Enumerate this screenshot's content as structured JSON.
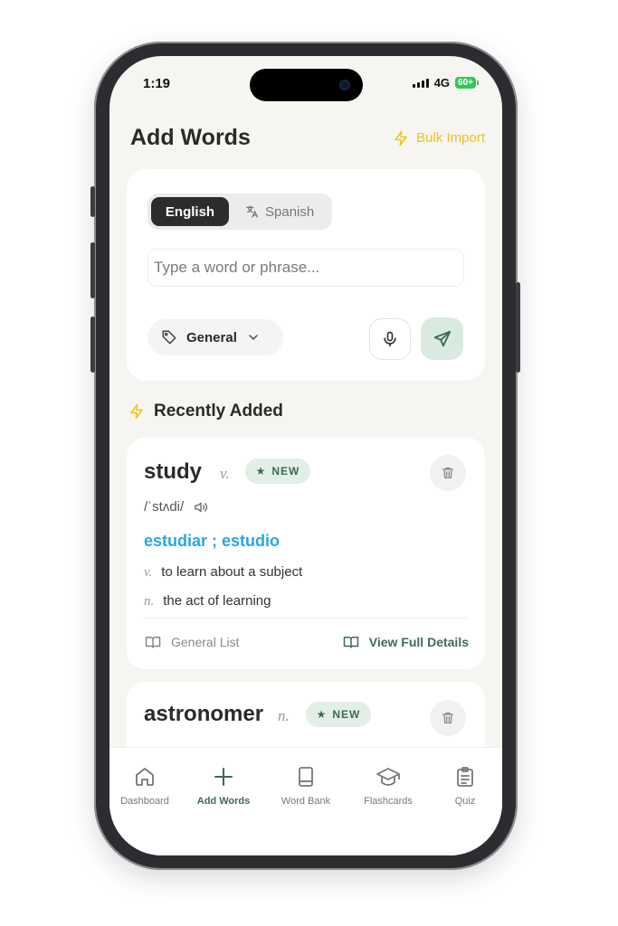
{
  "status_bar": {
    "time": "1:19",
    "network": "4G",
    "battery": "60+"
  },
  "header": {
    "title": "Add Words",
    "bulk_import_label": "Bulk Import"
  },
  "add_form": {
    "languages": [
      "English",
      "Spanish"
    ],
    "selected_language": "English",
    "input_placeholder": "Type a word or phrase...",
    "input_value": "",
    "category": "General"
  },
  "recent_section": {
    "title": "Recently Added"
  },
  "words": [
    {
      "word": "study",
      "pos": "v.",
      "badge": "NEW",
      "phonetic": "/ˈstʌdi/",
      "translation": "estudiar ; estudio",
      "definitions": [
        {
          "pos": "v.",
          "text": "to learn about a subject"
        },
        {
          "pos": "n.",
          "text": "the act of learning"
        }
      ],
      "list": "General List",
      "details_label": "View Full Details"
    },
    {
      "word": "astronomer",
      "pos": "n.",
      "badge": "NEW"
    }
  ],
  "tabs": [
    {
      "label": "Dashboard",
      "icon": "home-icon",
      "active": false
    },
    {
      "label": "Add Words",
      "icon": "plus-icon",
      "active": true
    },
    {
      "label": "Word Bank",
      "icon": "book-icon",
      "active": false
    },
    {
      "label": "Flashcards",
      "icon": "graduation-cap-icon",
      "active": false
    },
    {
      "label": "Quiz",
      "icon": "clipboard-icon",
      "active": false
    }
  ],
  "colors": {
    "accent_green": "#3d6b52",
    "badge_bg": "#e2efe7",
    "bulk_yellow": "#f0c419",
    "translation_blue": "#28a6e6",
    "screen_bg": "#f6f5f1"
  }
}
